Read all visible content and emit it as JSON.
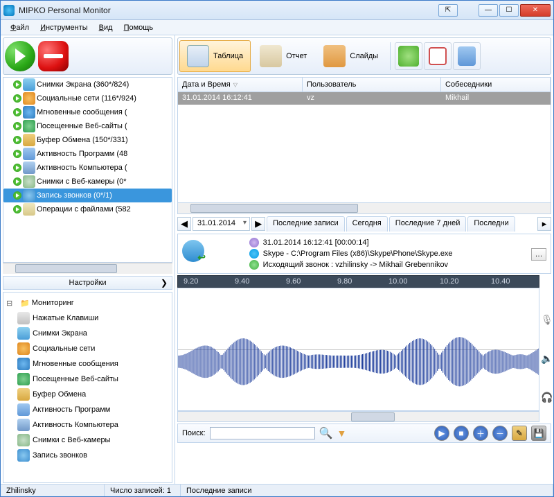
{
  "window": {
    "title": "MIPKO Personal Monitor"
  },
  "menu": {
    "file": "Файл",
    "tools": "Инструменты",
    "view": "Вид",
    "help": "Помощь"
  },
  "tree": [
    {
      "label": "Снимки Экрана (360*/824)",
      "icon": "ic-screen"
    },
    {
      "label": "Социальные сети (116*/924)",
      "icon": "ic-social"
    },
    {
      "label": "Мгновенные сообщения (",
      "icon": "ic-im"
    },
    {
      "label": "Посещенные Веб-сайты (",
      "icon": "ic-web"
    },
    {
      "label": "Буфер Обмена (150*/331)",
      "icon": "ic-clip"
    },
    {
      "label": "Активность Программ (48",
      "icon": "ic-prog"
    },
    {
      "label": "Активность Компьютера (",
      "icon": "ic-comp"
    },
    {
      "label": "Снимки с Веб-камеры (0*",
      "icon": "ic-cam"
    },
    {
      "label": "Запись звонков (0*/1)",
      "icon": "ic-call",
      "selected": true
    },
    {
      "label": "Операции с файлами (582",
      "icon": "ic-file"
    }
  ],
  "settings": {
    "header": "Настройки",
    "root": "Мониторинг",
    "items": [
      {
        "label": "Нажатые Клавиши",
        "icon": "ic-keys"
      },
      {
        "label": "Снимки Экрана",
        "icon": "ic-screen"
      },
      {
        "label": "Социальные сети",
        "icon": "ic-social"
      },
      {
        "label": "Мгновенные сообщения",
        "icon": "ic-im"
      },
      {
        "label": "Посещенные Веб-сайты",
        "icon": "ic-web"
      },
      {
        "label": "Буфер Обмена",
        "icon": "ic-clip"
      },
      {
        "label": "Активность Программ",
        "icon": "ic-prog"
      },
      {
        "label": "Активность Компьютера",
        "icon": "ic-comp"
      },
      {
        "label": "Снимки с Веб-камеры",
        "icon": "ic-cam"
      },
      {
        "label": "Запись звонков",
        "icon": "ic-call"
      }
    ]
  },
  "toolbar": {
    "table": "Таблица",
    "report": "Отчет",
    "slides": "Слайды"
  },
  "grid": {
    "columns": {
      "datetime": "Дата и Время",
      "user": "Пользователь",
      "peers": "Собеседники"
    },
    "rows": [
      {
        "datetime": "31.01.2014 16:12:41",
        "user": "vz",
        "peers": "Mikhail"
      }
    ]
  },
  "tabs": {
    "date": "31.01.2014",
    "latest": "Последние записи",
    "today": "Сегодня",
    "week": "Последние 7 дней",
    "more": "Последни"
  },
  "detail": {
    "title": "Запись звонков",
    "timestamp": "31.01.2014 16:12:41 [00:00:14]",
    "path": "Skype - C:\\Program Files (x86)\\Skype\\Phone\\Skype.exe",
    "callinfo": "Исходящий звонок : vzhilinsky -> Mikhail Grebennikov"
  },
  "ruler": [
    "9.20",
    "9.40",
    "9.60",
    "9.80",
    "10.00",
    "10.20",
    "10.40"
  ],
  "search": {
    "label": "Поиск:",
    "value": ""
  },
  "status": {
    "user": "Zhilinsky",
    "count_label": "Число записей:",
    "count": "1",
    "section": "Последние записи"
  }
}
